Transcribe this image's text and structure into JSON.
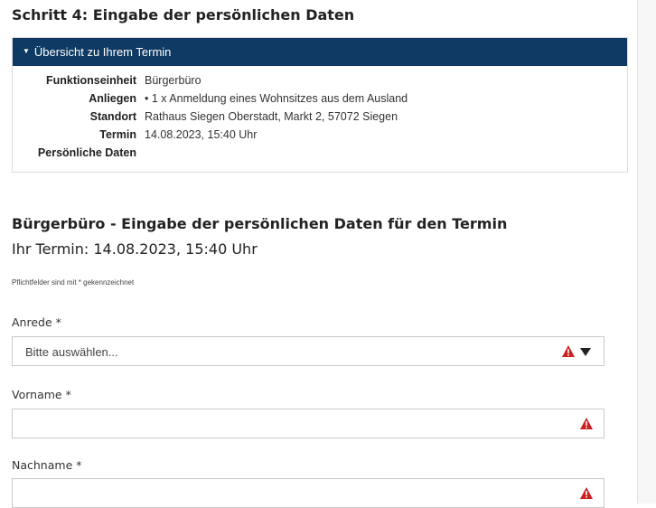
{
  "page": {
    "step_title": "Schritt 4: Eingabe der persönlichen Daten"
  },
  "overview": {
    "header_label": "Übersicht zu Ihrem Termin",
    "rows": [
      {
        "label": "Funktionseinheit",
        "value": "Bürgerbüro"
      },
      {
        "label": "Anliegen",
        "value": "• 1 x Anmeldung eines Wohnsitzes aus dem Ausland"
      },
      {
        "label": "Standort",
        "value": "Rathaus Siegen Oberstadt, Markt 2, 57072 Siegen"
      },
      {
        "label": "Termin",
        "value": "14.08.2023, 15:40 Uhr"
      },
      {
        "label": "Persönliche Daten",
        "value": ""
      }
    ]
  },
  "form": {
    "heading": "Bürgerbüro - Eingabe der persönlichen Daten für den Termin",
    "termin_line": "Ihr Termin: 14.08.2023, 15:40 Uhr",
    "required_note": "Pflichtfelder sind mit * gekennzeichnet",
    "anrede": {
      "label": "Anrede *",
      "selected": "Bitte auswählen..."
    },
    "vorname": {
      "label": "Vorname *",
      "value": ""
    },
    "nachname": {
      "label": "Nachname *",
      "value": ""
    }
  },
  "colors": {
    "header_bg": "#0f3a64",
    "warning": "#cc1f1f"
  },
  "icons": {
    "overview_toggle": "caret-down-icon",
    "field_error": "warning-triangle-icon",
    "select_arrow": "dropdown-arrow-icon"
  }
}
